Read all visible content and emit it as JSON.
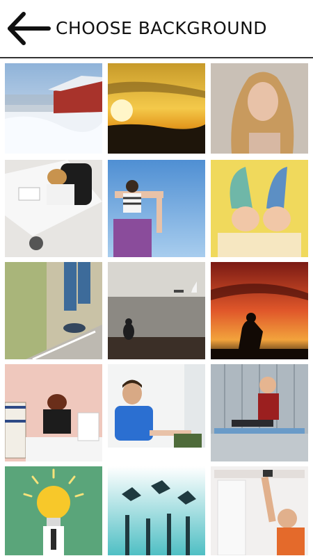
{
  "header": {
    "title": "CHOOSE BACKGROUND",
    "back_icon": "arrow-left-icon"
  },
  "backgrounds": [
    {
      "name": "winter-barn"
    },
    {
      "name": "sunset-sky"
    },
    {
      "name": "blonde-woman"
    },
    {
      "name": "office-desk-woman"
    },
    {
      "name": "child-on-shoulders"
    },
    {
      "name": "twin-babies"
    },
    {
      "name": "walking-path-legs"
    },
    {
      "name": "person-by-sea"
    },
    {
      "name": "praying-sunset"
    },
    {
      "name": "stressed-woman-papers"
    },
    {
      "name": "studying-man"
    },
    {
      "name": "happy-boy-bench"
    },
    {
      "name": "lightbulb-idea"
    },
    {
      "name": "graduation-hands"
    },
    {
      "name": "man-with-headphones"
    }
  ]
}
